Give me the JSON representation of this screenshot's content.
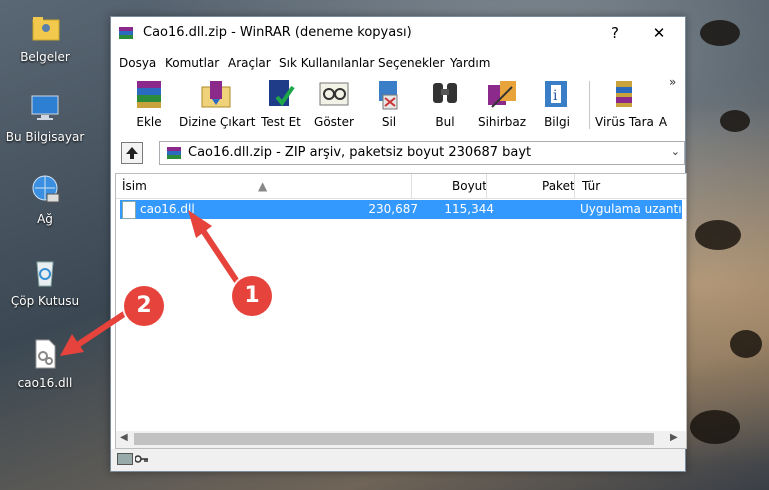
{
  "desktop": {
    "icons": [
      {
        "label": "Belgeler",
        "icon": "folder-user-icon"
      },
      {
        "label": "Bu Bilgisayar",
        "icon": "computer-icon"
      },
      {
        "label": "Ağ",
        "icon": "network-icon"
      },
      {
        "label": "Çöp Kutusu",
        "icon": "recycle-bin-icon"
      },
      {
        "label": "cao16.dll",
        "icon": "dll-file-icon"
      }
    ]
  },
  "window": {
    "title": "Cao16.dll.zip - WinRAR (deneme kopyası)",
    "help_button": "?",
    "close_button": "✕"
  },
  "menu": [
    "Dosya",
    "Komutlar",
    "Araçlar",
    "Sık Kullanılanlar",
    "Seçenekler",
    "Yardım"
  ],
  "toolbar": [
    {
      "label": "Ekle",
      "icon": "add-archive-icon"
    },
    {
      "label": "Dizine Çıkart",
      "icon": "extract-to-folder-icon"
    },
    {
      "label": "Test Et",
      "icon": "test-archive-icon"
    },
    {
      "label": "Göster",
      "icon": "view-icon"
    },
    {
      "label": "Sil",
      "icon": "delete-icon"
    },
    {
      "label": "Bul",
      "icon": "find-icon"
    },
    {
      "label": "Sihirbaz",
      "icon": "wizard-icon"
    },
    {
      "label": "Bilgi",
      "icon": "info-icon"
    },
    {
      "label": "Virüs Tara",
      "icon": "virus-scan-icon"
    },
    {
      "label": "A",
      "icon": "comment-icon"
    }
  ],
  "toolbar_overflow": "»",
  "address": {
    "text": "Cao16.dll.zip - ZIP arşiv, paketsiz boyut 230687 bayt"
  },
  "columns": {
    "name": "İsim",
    "size": "Boyut",
    "packed": "Paket",
    "type": "Tür"
  },
  "files": [
    {
      "name": "cao16.dll",
      "size": "230,687",
      "packed": "115,344",
      "type": "Uygulama uzantısı",
      "selected": true
    }
  ],
  "callouts": {
    "one": "1",
    "two": "2"
  },
  "colors": {
    "selection": "#3399ff",
    "callout": "#e5433b"
  }
}
